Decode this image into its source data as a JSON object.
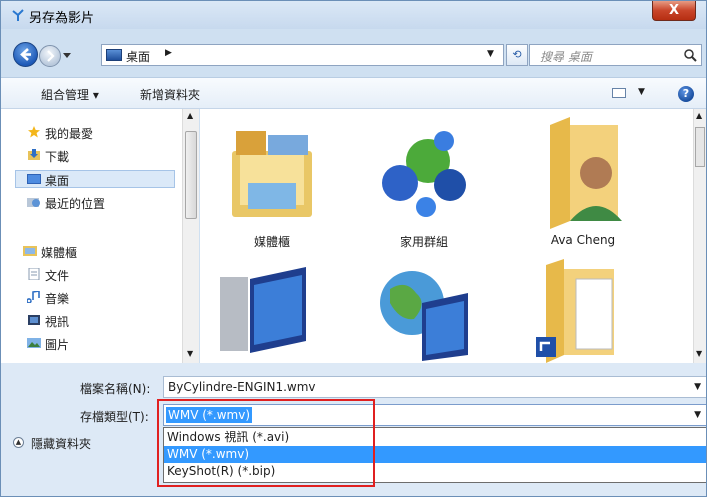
{
  "window": {
    "title": "另存為影片",
    "close_label": "X"
  },
  "address": {
    "location": "桌面",
    "arrow": "▶"
  },
  "search": {
    "placeholder": "搜尋 桌面"
  },
  "toolbar": {
    "organize": "組合管理 ▾",
    "new_folder": "新增資料夾"
  },
  "nav": {
    "items": [
      {
        "label": "我的最愛"
      },
      {
        "label": "下載"
      },
      {
        "label": "桌面"
      },
      {
        "label": "最近的位置"
      },
      {
        "label": "媒體櫃"
      },
      {
        "label": "文件"
      },
      {
        "label": "音樂"
      },
      {
        "label": "視訊"
      },
      {
        "label": "圖片"
      }
    ]
  },
  "content": {
    "tiles": [
      {
        "label": "媒體櫃"
      },
      {
        "label": "家用群組"
      },
      {
        "label": "Ava Cheng"
      }
    ]
  },
  "form": {
    "filename_label": "檔案名稱(N):",
    "filename_value": "ByCylindre-ENGIN1.wmv",
    "filetype_label": "存檔類型(T):",
    "filetype_value": "WMV (*.wmv)",
    "filetype_options": [
      {
        "label": "Windows 視訊 (*.avi)"
      },
      {
        "label": "WMV (*.wmv)"
      },
      {
        "label": "KeyShot(R) (*.bip)"
      }
    ],
    "selected_option_index": 1
  },
  "footer": {
    "hide_folders": "隱藏資料夾"
  },
  "colors": {
    "selection": "#3399ff",
    "highlight_box": "#e02020"
  }
}
